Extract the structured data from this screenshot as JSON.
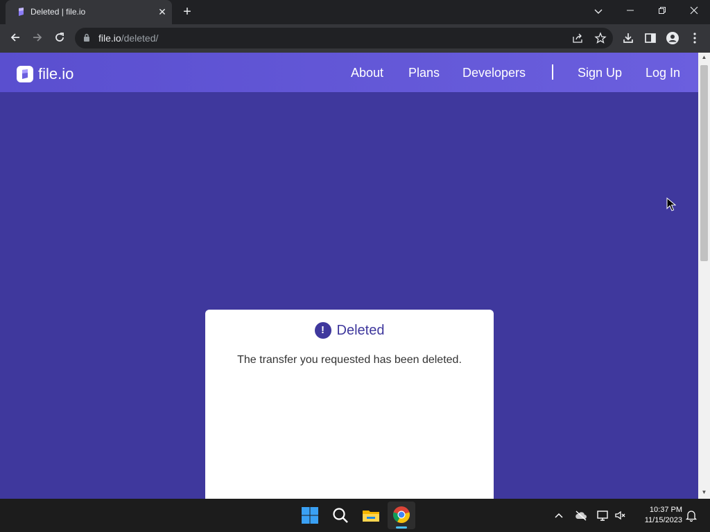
{
  "browser": {
    "tab_title": "Deleted | file.io",
    "url_host": "file.io",
    "url_path": "/deleted/"
  },
  "site": {
    "logo_text": "file.io",
    "nav": {
      "about": "About",
      "plans": "Plans",
      "developers": "Developers",
      "sign_up": "Sign Up",
      "log_in": "Log In"
    }
  },
  "card": {
    "icon_symbol": "!",
    "title": "Deleted",
    "message": "The transfer you requested has been deleted."
  },
  "taskbar": {
    "time": "10:37 PM",
    "date": "11/15/2023"
  },
  "colors": {
    "page_bg": "#3f389d",
    "nav_bg": "#6b5fde",
    "accent": "#3f389d"
  }
}
